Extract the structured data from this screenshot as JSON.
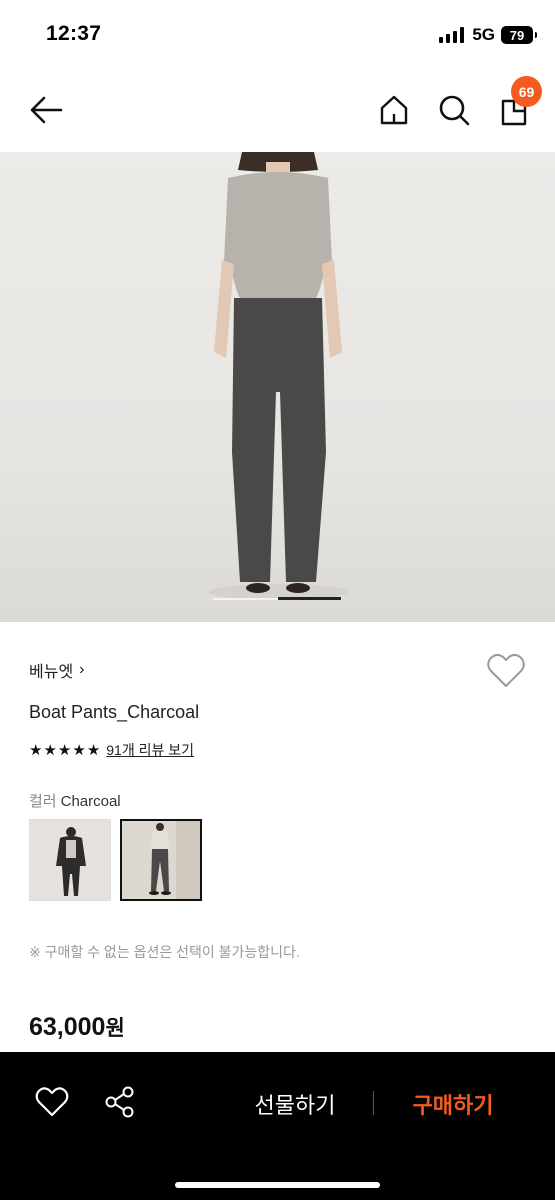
{
  "status_bar": {
    "time": "12:37",
    "network": "5G",
    "battery": "79"
  },
  "nav": {
    "cart_count": "69",
    "icons": [
      "back-arrow-icon",
      "home-icon",
      "search-icon",
      "shopping-bag-icon"
    ]
  },
  "product": {
    "brand": "베뉴엣",
    "brand_chevron": "›",
    "title": "Boat Pants_Charcoal",
    "rating_stars": 5,
    "review_link": "91개 리뷰 보기",
    "option_key": "컬러",
    "option_value": "Charcoal",
    "notice": "※ 구매할 수 없는 옵션은 선택이 불가능합니다.",
    "price": "63,000",
    "price_unit": "원"
  },
  "image_gallery": {
    "current_fraction": 0.5
  },
  "bottom_bar": {
    "gift_label": "선물하기",
    "buy_label": "구매하기"
  },
  "colors": {
    "accent": "#f25c1e",
    "bottom_bar_bg": "#000000"
  }
}
